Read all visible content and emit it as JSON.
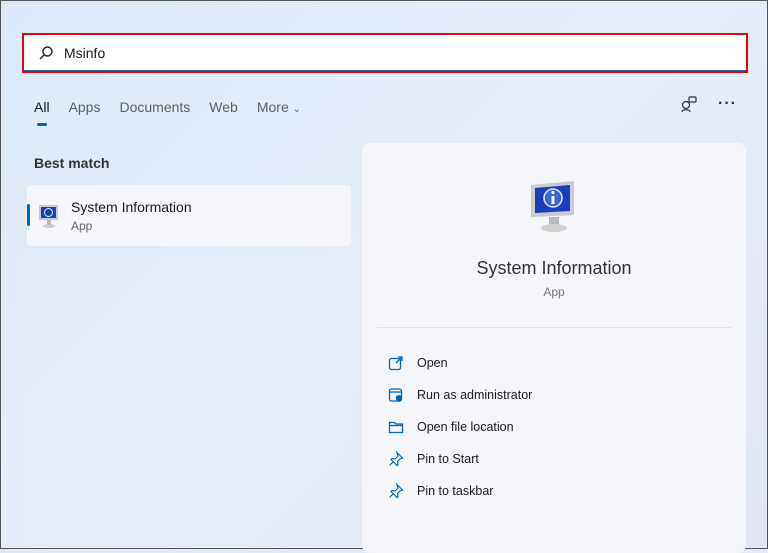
{
  "search": {
    "value": "Msinfo"
  },
  "tabs": [
    "All",
    "Apps",
    "Documents",
    "Web",
    "More"
  ],
  "best_match_label": "Best match",
  "result": {
    "title": "System Information",
    "subtitle": "App"
  },
  "detail": {
    "title": "System Information",
    "subtitle": "App",
    "actions": [
      "Open",
      "Run as administrator",
      "Open file location",
      "Pin to Start",
      "Pin to taskbar"
    ]
  },
  "colors": {
    "accent": "#0067c0",
    "highlight_border": "#e8000b"
  }
}
